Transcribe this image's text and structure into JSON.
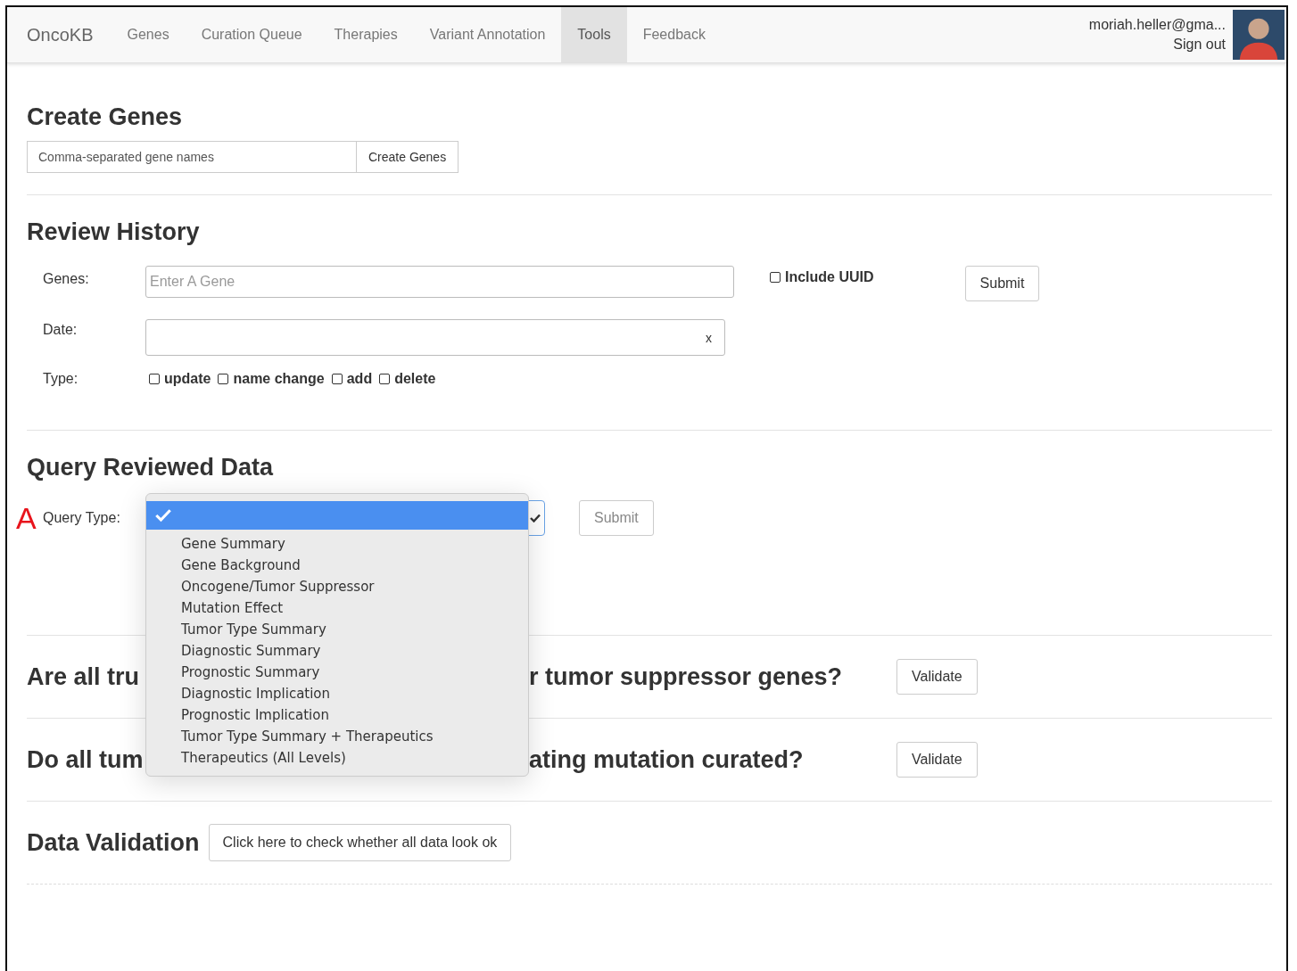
{
  "navbar": {
    "brand": "OncoKB",
    "items": [
      {
        "label": "Genes",
        "selected": false
      },
      {
        "label": "Curation Queue",
        "selected": false
      },
      {
        "label": "Therapies",
        "selected": false
      },
      {
        "label": "Variant Annotation",
        "selected": false
      },
      {
        "label": "Tools",
        "selected": true
      },
      {
        "label": "Feedback",
        "selected": false
      }
    ],
    "user_email": "moriah.heller@gma...",
    "sign_out": "Sign out"
  },
  "create_genes": {
    "title": "Create Genes",
    "input": {
      "placeholder": "Comma-separated gene names"
    },
    "button": "Create Genes"
  },
  "review_history": {
    "title": "Review History",
    "genes_label": "Genes:",
    "genes_input": {
      "placeholder": "Enter A Gene"
    },
    "include_uuid": {
      "label": "Include UUID",
      "checked": false
    },
    "submit": "Submit",
    "date_label": "Date:",
    "date_clear": "x",
    "type_label": "Type:",
    "types": [
      {
        "label": "update",
        "checked": false
      },
      {
        "label": "name change",
        "checked": false
      },
      {
        "label": "add",
        "checked": false
      },
      {
        "label": "delete",
        "checked": false
      }
    ]
  },
  "query_reviewed_data": {
    "title": "Query Reviewed Data",
    "annotation_marker": "A",
    "query_type_label": "Query Type:",
    "submit": "Submit",
    "options": [
      {
        "selected": true
      },
      {
        "label": "Gene Summary",
        "selected": false
      },
      {
        "label": "Gene Background",
        "selected": false
      },
      {
        "label": "Oncogene/Tumor Suppressor",
        "selected": false
      },
      {
        "label": "Mutation Effect",
        "selected": false
      },
      {
        "label": "Tumor Type Summary",
        "selected": false
      },
      {
        "label": "Diagnostic Summary",
        "selected": false
      },
      {
        "label": "Prognostic Summary",
        "selected": false
      },
      {
        "label": "Diagnostic Implication",
        "selected": false
      },
      {
        "label": "Prognostic Implication",
        "selected": false
      },
      {
        "label": "Tumor Type Summary + Therapeutics",
        "selected": false
      },
      {
        "label": "Therapeutics (All Levels)",
        "selected": false
      }
    ]
  },
  "validations": [
    {
      "question_start": "Are all tru",
      "question_end": "r tumor suppressor genes?",
      "button": "Validate"
    },
    {
      "question_start": "Do all tum",
      "question_end": "ating mutation curated?",
      "button": "Validate"
    }
  ],
  "data_validation": {
    "title": "Data Validation",
    "button": "Click here to check whether all data look ok"
  }
}
